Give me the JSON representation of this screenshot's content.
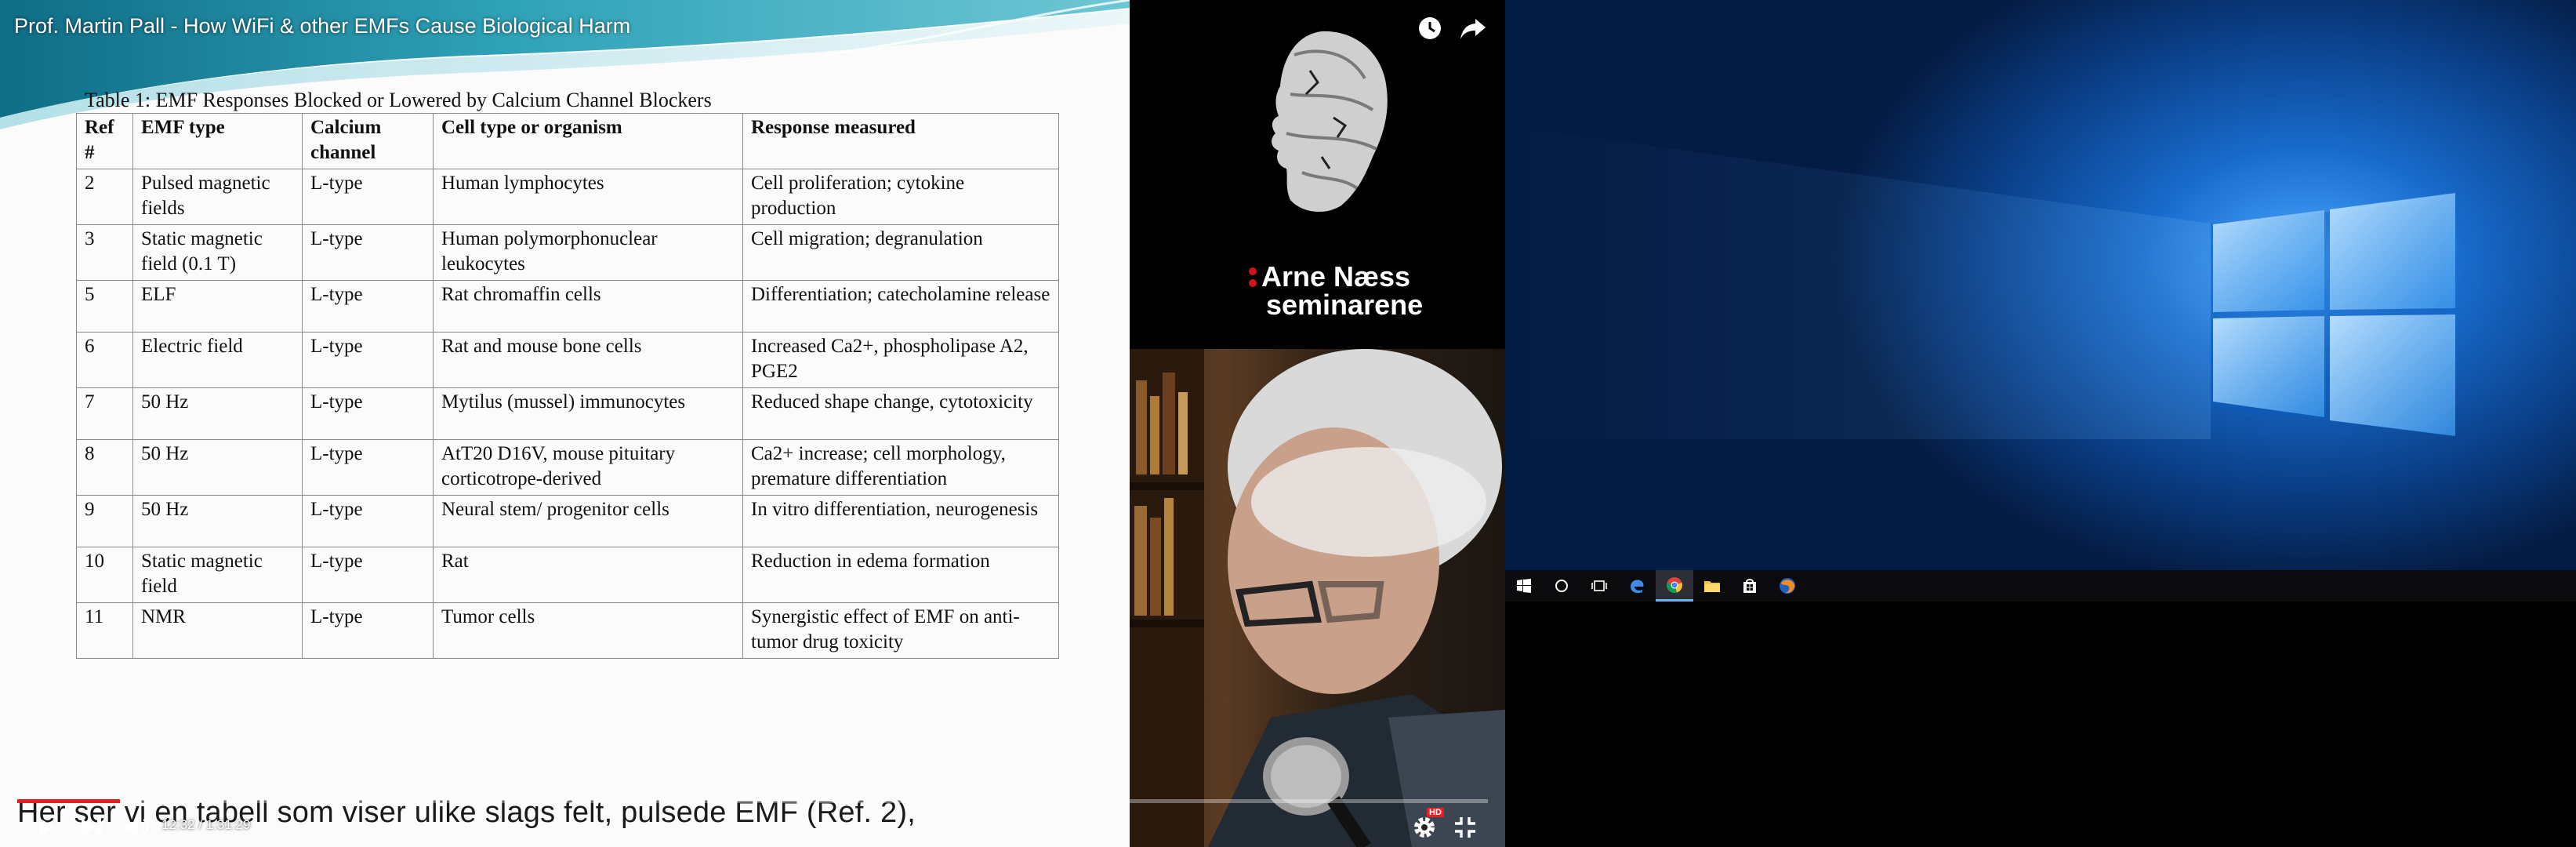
{
  "video": {
    "title": "Prof. Martin Pall - How WiFi & other EMFs Cause Biological Harm",
    "subtitle": "Her ser vi en tabell som viser ulike slags felt, pulsede EMF (Ref. 2),",
    "time": "12:32 / 1:31:29",
    "progress_fraction": 0.07,
    "hd_badge": "HD",
    "accent_color": "#e52020"
  },
  "slide": {
    "caption": "Table 1:  EMF Responses Blocked or Lowered by Calcium Channel Blockers",
    "headers": [
      "Ref #",
      "EMF type",
      "Calcium channel",
      "Cell type or organism",
      "Response measured"
    ],
    "rows": [
      [
        "2",
        "Pulsed magnetic fields",
        "L-type",
        "Human lymphocytes",
        "Cell proliferation; cytokine production"
      ],
      [
        "3",
        "Static magnetic field (0.1 T)",
        "L-type",
        "Human polymorphonuclear leukocytes",
        "Cell migration; degranulation"
      ],
      [
        "5",
        "ELF",
        "L-type",
        "Rat chromaffin cells",
        "Differentiation; catecholamine release"
      ],
      [
        "6",
        "Electric field",
        "L-type",
        "Rat and mouse bone cells",
        "Increased Ca2+, phospholipase A2, PGE2"
      ],
      [
        "7",
        "50 Hz",
        "L-type",
        "Mytilus (mussel) immunocytes",
        "Reduced shape change, cytotoxicity"
      ],
      [
        "8",
        "50 Hz",
        "L-type",
        "AtT20 D16V, mouse pituitary corticotrope-derived",
        "Ca2+ increase; cell morphology, premature differentiation"
      ],
      [
        "9",
        "50 Hz",
        "L-type",
        "Neural stem/ progenitor cells",
        "In vitro differentiation, neurogenesis"
      ],
      [
        "10",
        "Static magnetic field",
        "L-type",
        "Rat",
        "Reduction in edema formation"
      ],
      [
        "11",
        "NMR",
        "L-type",
        "Tumor cells",
        "Synergistic effect of EMF on anti-tumor drug toxicity"
      ]
    ]
  },
  "brand": {
    "line1": "Arne Næss",
    "line2": "seminarene",
    "accent_color": "#d0141b"
  },
  "icons": {
    "watch_later": "clock-icon",
    "share": "share-arrow-icon",
    "play": "play-icon",
    "next": "next-icon",
    "volume": "volume-icon",
    "settings": "gear-icon",
    "exit_fullscreen": "exit-fullscreen-icon"
  },
  "taskbar": {
    "items": [
      "windows-start-icon",
      "cortana-search-icon",
      "task-view-icon",
      "edge-icon",
      "chrome-icon",
      "file-explorer-icon",
      "store-icon",
      "firefox-icon"
    ],
    "active_item": "chrome-icon"
  }
}
